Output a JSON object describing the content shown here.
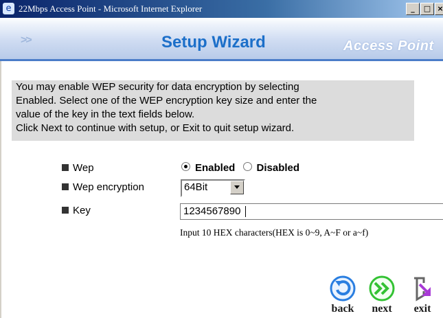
{
  "window": {
    "title": "22Mbps Access Point - Microsoft Internet Explorer",
    "buttons": [
      "_",
      "□",
      "×"
    ]
  },
  "banner": {
    "arrows": ">>",
    "title": "Setup Wizard",
    "brand": "Access Point"
  },
  "info": {
    "lines": [
      "You may enable WEP security for data encryption by selecting",
      "Enabled. Select one of the WEP encryption key size and enter the",
      "value of the key in the text fields below.",
      "Click Next to continue with setup, or Exit to quit setup wizard."
    ]
  },
  "form": {
    "wep_label": "Wep",
    "wep_options": {
      "enabled": "Enabled",
      "disabled": "Disabled",
      "selected": "Enabled"
    },
    "encryption_label": "Wep encryption",
    "encryption_value": "64Bit",
    "key_label": "Key",
    "key_value": "1234567890",
    "key_hint": "Input 10 HEX characters(HEX is 0~9, A~F or a~f)"
  },
  "nav": {
    "back": "back",
    "next": "next",
    "exit": "exit"
  },
  "colors": {
    "title_blue": "#1c6fc9",
    "info_bg": "#dcdcdc",
    "next_green": "#33c233",
    "back_blue": "#2a7ee0",
    "exit_purple": "#a83ad6"
  }
}
